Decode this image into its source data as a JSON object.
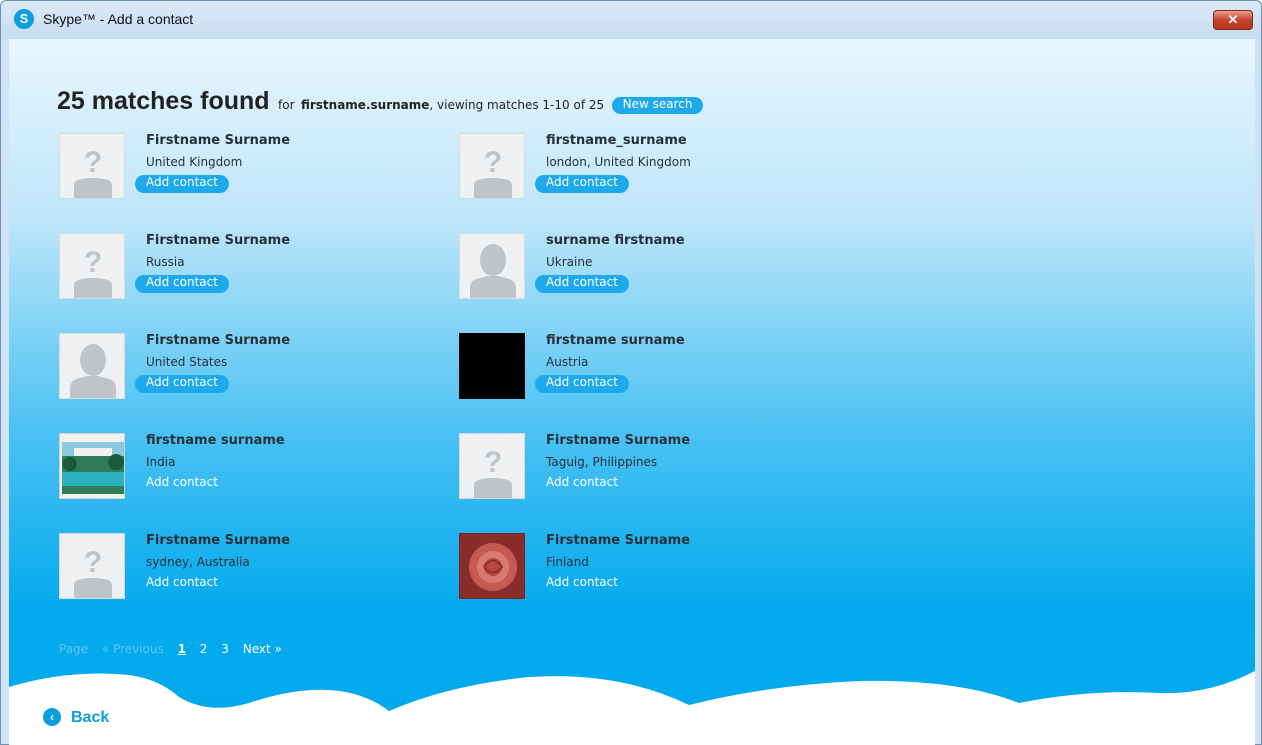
{
  "window": {
    "title": "Skype™ - Add a contact",
    "logo_letter": "S",
    "close_glyph": "✕"
  },
  "heading": {
    "count_text": "25 matches found",
    "for_prefix": "for",
    "query": "firstname.surname",
    "viewing": ", viewing matches 1-10 of 25",
    "new_search_label": "New search"
  },
  "contacts": [
    {
      "name": "Firstname Surname",
      "location": "United Kingdom",
      "add_label": "Add contact",
      "avatar": "unknown-icon"
    },
    {
      "name": "firstname_surname",
      "location": "london, United Kingdom",
      "add_label": "Add contact",
      "avatar": "unknown-icon"
    },
    {
      "name": "Firstname Surname",
      "location": "Russia",
      "add_label": "Add contact",
      "avatar": "unknown-icon"
    },
    {
      "name": "surname firstname",
      "location": "Ukraine",
      "add_label": "Add contact",
      "avatar": "person-silhouette-icon"
    },
    {
      "name": "Firstname Surname",
      "location": "United States",
      "add_label": "Add contact",
      "avatar": "person-silhouette-icon"
    },
    {
      "name": "firstname surname",
      "location": "Austria",
      "add_label": "Add contact",
      "avatar": "black-photo"
    },
    {
      "name": "firstname surname",
      "location": "India",
      "add_label": "Add contact",
      "avatar": "resort-photo"
    },
    {
      "name": "Firstname Surname",
      "location": "Taguig, Philippines",
      "add_label": "Add contact",
      "avatar": "unknown-icon"
    },
    {
      "name": "Firstname Surname",
      "location": "sydney, Australia",
      "add_label": "Add contact",
      "avatar": "unknown-icon"
    },
    {
      "name": "Firstname Surname",
      "location": "Finland",
      "add_label": "Add contact",
      "avatar": "rose-photo"
    }
  ],
  "pagination": {
    "page_label": "Page",
    "previous_label": "« Previous",
    "pages": [
      "1",
      "2",
      "3"
    ],
    "current_page": "1",
    "next_label": "Next »"
  },
  "footer": {
    "back_label": "Back",
    "back_icon": "chevron-left-icon"
  }
}
